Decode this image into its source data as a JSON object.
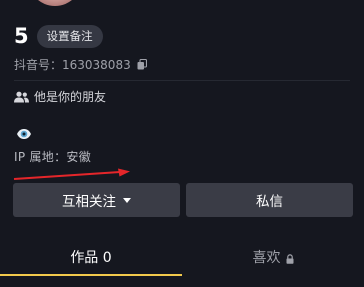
{
  "profile": {
    "name": "5",
    "remark_button": "设置备注",
    "douyin_id": "抖音号：163038083",
    "friend_text": "他是你的朋友",
    "ip_location": "IP 属地：安徽"
  },
  "buttons": {
    "follow": "互相关注",
    "message": "私信"
  },
  "tabs": {
    "works": "作品 0",
    "likes": "喜欢"
  },
  "colors": {
    "background": "#15171f",
    "button_bg": "#3a3c46",
    "tab_underline": "#f2c94c",
    "arrow": "#e5262a",
    "eye_icon": "#5fa8d3"
  },
  "icons": {
    "copy": "copy-icon",
    "friends": "friends-icon",
    "eye": "eye-icon",
    "dropdown": "caret-down-icon",
    "lock": "lock-icon"
  }
}
